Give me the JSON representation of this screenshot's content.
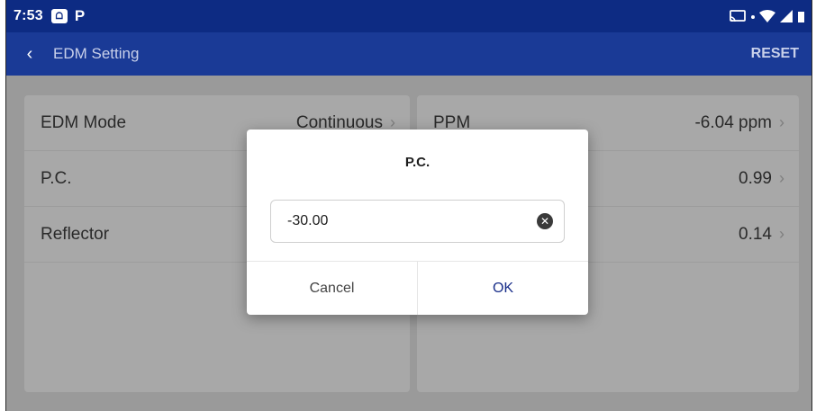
{
  "status_bar": {
    "time": "7:53",
    "app_icon_text": "ᗝ",
    "p_icon_text": "P"
  },
  "app_bar": {
    "back_glyph": "‹",
    "title": "EDM Setting",
    "reset_label": "RESET"
  },
  "settings": {
    "left": [
      {
        "label": "EDM Mode",
        "value": "Continuous"
      },
      {
        "label": "P.C.",
        "value": ""
      },
      {
        "label": "Reflector",
        "value": ""
      }
    ],
    "right": [
      {
        "label": "PPM",
        "value": "-6.04 ppm"
      },
      {
        "label": "",
        "value": "0.99"
      },
      {
        "label": "",
        "value": "0.14"
      }
    ],
    "chevron": "›"
  },
  "dialog": {
    "title": "P.C.",
    "input_value": "-30.00",
    "clear_glyph": "✕",
    "cancel_label": "Cancel",
    "ok_label": "OK"
  },
  "colors": {
    "status_bar": "#0d2b83",
    "app_bar": "#1a3a96",
    "accent": "#1a2f8a"
  }
}
